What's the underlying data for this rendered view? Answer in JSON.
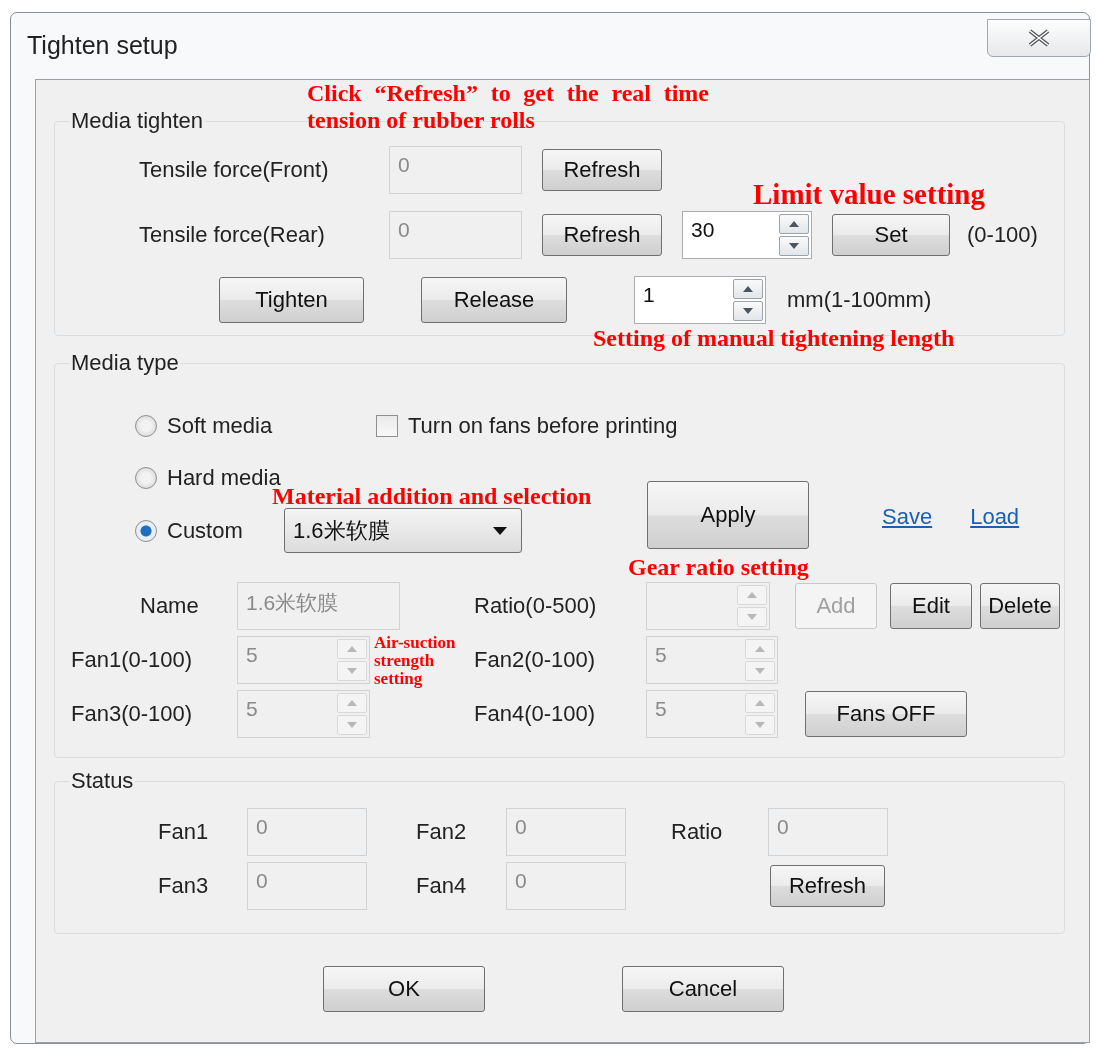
{
  "window": {
    "title": "Tighten setup"
  },
  "media_tighten": {
    "title": "Media tighten",
    "forces": [
      {
        "label": "Tensile force(Front)",
        "value": "0",
        "disabled": true,
        "refresh": "Refresh"
      },
      {
        "label": "Tensile force(Rear)",
        "value": "0",
        "disabled": true,
        "refresh": "Refresh"
      }
    ],
    "limit": {
      "value": "30",
      "button": "Set",
      "range": "(0-100)"
    },
    "tighten": "Tighten",
    "release": "Release",
    "length": {
      "value": "1",
      "unit": "mm(1-100mm)"
    }
  },
  "media_type": {
    "title": "Media type",
    "radios": [
      {
        "label": "Soft media",
        "selected": false
      },
      {
        "label": "Hard media",
        "selected": false
      },
      {
        "label": "Custom",
        "selected": true
      }
    ],
    "fans_checkbox": {
      "label": "Turn on fans before printing",
      "checked": false
    },
    "material": "1.6米软膜",
    "apply": "Apply",
    "links": [
      "Save",
      "Load"
    ],
    "name": {
      "label": "Name",
      "value": "1.6米软膜",
      "disabled": true
    },
    "ratio": {
      "label": "Ratio(0-500)",
      "disabled": true
    },
    "add": {
      "label": "Add",
      "disabled": true
    },
    "edit": "Edit",
    "delete": "Delete",
    "fans": [
      {
        "label": "Fan1(0-100)",
        "value": "5",
        "disabled": true
      },
      {
        "label": "Fan2(0-100)",
        "value": "5",
        "disabled": true
      },
      {
        "label": "Fan3(0-100)",
        "value": "5",
        "disabled": true
      },
      {
        "label": "Fan4(0-100)",
        "value": "5",
        "disabled": true
      }
    ],
    "fans_off": "Fans OFF"
  },
  "status": {
    "title": "Status",
    "fields": [
      {
        "label": "Fan1",
        "value": "0"
      },
      {
        "label": "Fan2",
        "value": "0"
      },
      {
        "label": "Ratio",
        "value": "0"
      },
      {
        "label": "Fan3",
        "value": "0"
      },
      {
        "label": "Fan4",
        "value": "0"
      }
    ],
    "refresh": "Refresh"
  },
  "buttons": [
    "OK",
    "Cancel"
  ],
  "annotations": [
    "Click “Refresh” to get the real time tension of rubber rolls",
    "Limit value setting",
    "Setting of manual tightening length",
    "Material addition and selection",
    "Gear ratio setting",
    "Air-suction strength setting"
  ]
}
